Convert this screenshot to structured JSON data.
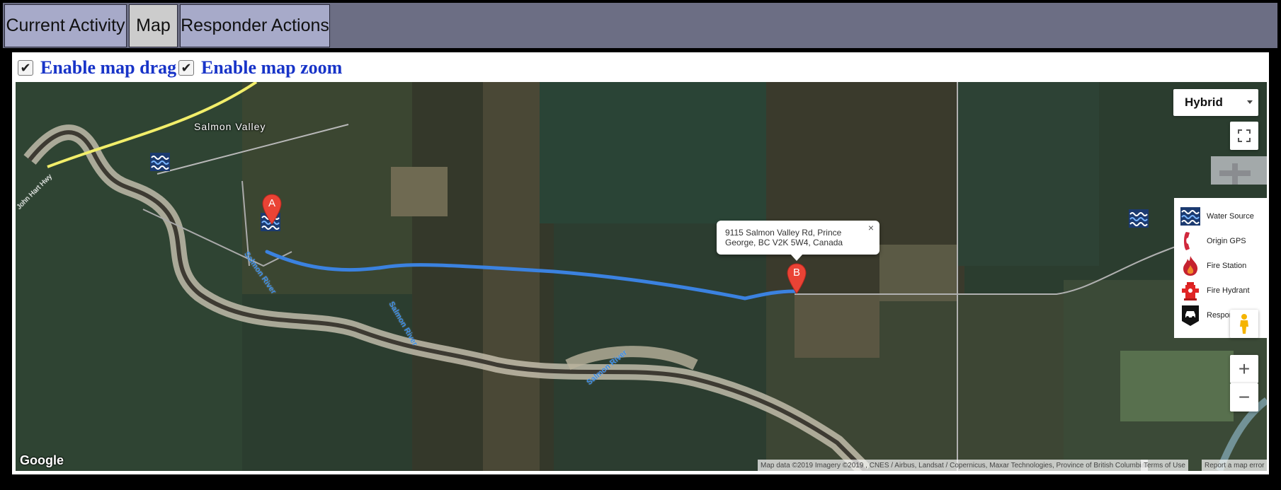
{
  "tabs": [
    {
      "label": "Current Activity",
      "active": false
    },
    {
      "label": "Map",
      "active": true
    },
    {
      "label": "Responder Actions",
      "active": false
    }
  ],
  "controls": {
    "drag": {
      "label": "Enable map drag",
      "checked": true
    },
    "zoom": {
      "label": "Enable map zoom",
      "checked": true
    }
  },
  "map": {
    "map_type": "Hybrid",
    "place_label": "Salmon Valley",
    "road_label": "John Hart Hwy",
    "river_labels": [
      "Salmon River",
      "Salmon River",
      "Salmon River"
    ],
    "marker_a": "A",
    "marker_b": "B",
    "info_window": {
      "address": "9115 Salmon Valley Rd, Prince George, BC V2K 5W4, Canada",
      "close": "×"
    },
    "zoom_in": "+",
    "zoom_out": "−",
    "google": "Google",
    "attribution": "Map data ©2019 Imagery ©2019 , CNES / Airbus, Landsat / Copernicus, Maxar Technologies, Province of British Columbia",
    "terms": "Terms of Use",
    "report": "Report a map error",
    "route_color": "#3b82e0"
  },
  "legend": [
    {
      "icon": "water-source-icon",
      "label": "Water Source"
    },
    {
      "icon": "phone-icon",
      "label": "Origin GPS"
    },
    {
      "icon": "fire-icon",
      "label": "Fire Station"
    },
    {
      "icon": "hydrant-icon",
      "label": "Fire Hydrant"
    },
    {
      "icon": "car-icon",
      "label": "Responder"
    }
  ]
}
